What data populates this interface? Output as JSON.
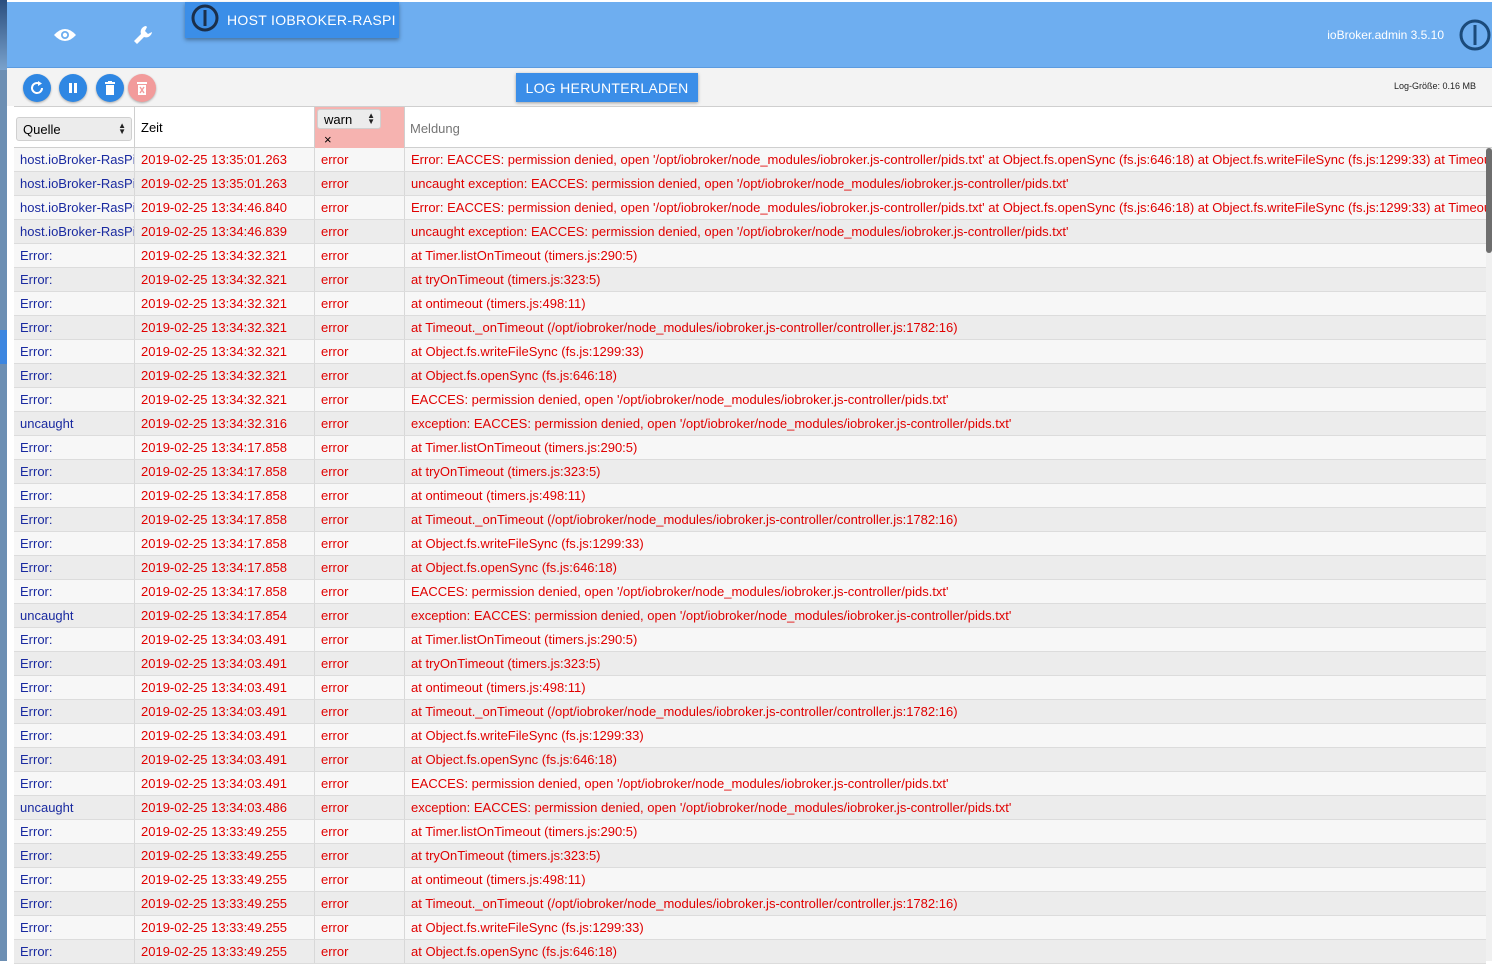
{
  "header": {
    "host_tab_label": "HOST IOBROKER-RASPI",
    "version": "ioBroker.admin 3.5.10",
    "icons": [
      "eye-icon",
      "wrench-icon",
      "iobroker-logo"
    ]
  },
  "toolbar": {
    "download_label": "LOG HERUNTERLADEN",
    "log_size": "Log-Größe: 0.16 MB",
    "buttons": [
      "refresh-icon",
      "pause-icon",
      "trash-icon",
      "delete-disabled-icon"
    ]
  },
  "table": {
    "source_filter": "Quelle",
    "time_header": "Zeit",
    "severity_filter": "warn",
    "clear_filter": "×",
    "message_placeholder": "Meldung",
    "rows": [
      {
        "src": "host.ioBroker-RasPi",
        "time": "2019-02-25 13:35:01.263",
        "sev": "error",
        "msg": "Error: EACCES: permission denied, open '/opt/iobroker/node_modules/iobroker.js-controller/pids.txt' at Object.fs.openSync (fs.js:646:18) at Object.fs.writeFileSync (fs.js:1299:33) at Timeout._onTimeout"
      },
      {
        "src": "host.ioBroker-RasPi",
        "time": "2019-02-25 13:35:01.263",
        "sev": "error",
        "msg": "uncaught exception: EACCES: permission denied, open '/opt/iobroker/node_modules/iobroker.js-controller/pids.txt'"
      },
      {
        "src": "host.ioBroker-RasPi",
        "time": "2019-02-25 13:34:46.840",
        "sev": "error",
        "msg": "Error: EACCES: permission denied, open '/opt/iobroker/node_modules/iobroker.js-controller/pids.txt' at Object.fs.openSync (fs.js:646:18) at Object.fs.writeFileSync (fs.js:1299:33) at Timeout._onTimeout"
      },
      {
        "src": "host.ioBroker-RasPi",
        "time": "2019-02-25 13:34:46.839",
        "sev": "error",
        "msg": "uncaught exception: EACCES: permission denied, open '/opt/iobroker/node_modules/iobroker.js-controller/pids.txt'"
      },
      {
        "src": "Error:",
        "time": "2019-02-25 13:34:32.321",
        "sev": "error",
        "msg": "at Timer.listOnTimeout (timers.js:290:5)"
      },
      {
        "src": "Error:",
        "time": "2019-02-25 13:34:32.321",
        "sev": "error",
        "msg": "at tryOnTimeout (timers.js:323:5)"
      },
      {
        "src": "Error:",
        "time": "2019-02-25 13:34:32.321",
        "sev": "error",
        "msg": "at ontimeout (timers.js:498:11)"
      },
      {
        "src": "Error:",
        "time": "2019-02-25 13:34:32.321",
        "sev": "error",
        "msg": "at Timeout._onTimeout (/opt/iobroker/node_modules/iobroker.js-controller/controller.js:1782:16)"
      },
      {
        "src": "Error:",
        "time": "2019-02-25 13:34:32.321",
        "sev": "error",
        "msg": "at Object.fs.writeFileSync (fs.js:1299:33)"
      },
      {
        "src": "Error:",
        "time": "2019-02-25 13:34:32.321",
        "sev": "error",
        "msg": "at Object.fs.openSync (fs.js:646:18)"
      },
      {
        "src": "Error:",
        "time": "2019-02-25 13:34:32.321",
        "sev": "error",
        "msg": "EACCES: permission denied, open '/opt/iobroker/node_modules/iobroker.js-controller/pids.txt'"
      },
      {
        "src": "uncaught",
        "time": "2019-02-25 13:34:32.316",
        "sev": "error",
        "msg": "exception: EACCES: permission denied, open '/opt/iobroker/node_modules/iobroker.js-controller/pids.txt'"
      },
      {
        "src": "Error:",
        "time": "2019-02-25 13:34:17.858",
        "sev": "error",
        "msg": "at Timer.listOnTimeout (timers.js:290:5)"
      },
      {
        "src": "Error:",
        "time": "2019-02-25 13:34:17.858",
        "sev": "error",
        "msg": "at tryOnTimeout (timers.js:323:5)"
      },
      {
        "src": "Error:",
        "time": "2019-02-25 13:34:17.858",
        "sev": "error",
        "msg": "at ontimeout (timers.js:498:11)"
      },
      {
        "src": "Error:",
        "time": "2019-02-25 13:34:17.858",
        "sev": "error",
        "msg": "at Timeout._onTimeout (/opt/iobroker/node_modules/iobroker.js-controller/controller.js:1782:16)"
      },
      {
        "src": "Error:",
        "time": "2019-02-25 13:34:17.858",
        "sev": "error",
        "msg": "at Object.fs.writeFileSync (fs.js:1299:33)"
      },
      {
        "src": "Error:",
        "time": "2019-02-25 13:34:17.858",
        "sev": "error",
        "msg": "at Object.fs.openSync (fs.js:646:18)"
      },
      {
        "src": "Error:",
        "time": "2019-02-25 13:34:17.858",
        "sev": "error",
        "msg": "EACCES: permission denied, open '/opt/iobroker/node_modules/iobroker.js-controller/pids.txt'"
      },
      {
        "src": "uncaught",
        "time": "2019-02-25 13:34:17.854",
        "sev": "error",
        "msg": "exception: EACCES: permission denied, open '/opt/iobroker/node_modules/iobroker.js-controller/pids.txt'"
      },
      {
        "src": "Error:",
        "time": "2019-02-25 13:34:03.491",
        "sev": "error",
        "msg": "at Timer.listOnTimeout (timers.js:290:5)"
      },
      {
        "src": "Error:",
        "time": "2019-02-25 13:34:03.491",
        "sev": "error",
        "msg": "at tryOnTimeout (timers.js:323:5)"
      },
      {
        "src": "Error:",
        "time": "2019-02-25 13:34:03.491",
        "sev": "error",
        "msg": "at ontimeout (timers.js:498:11)"
      },
      {
        "src": "Error:",
        "time": "2019-02-25 13:34:03.491",
        "sev": "error",
        "msg": "at Timeout._onTimeout (/opt/iobroker/node_modules/iobroker.js-controller/controller.js:1782:16)"
      },
      {
        "src": "Error:",
        "time": "2019-02-25 13:34:03.491",
        "sev": "error",
        "msg": "at Object.fs.writeFileSync (fs.js:1299:33)"
      },
      {
        "src": "Error:",
        "time": "2019-02-25 13:34:03.491",
        "sev": "error",
        "msg": "at Object.fs.openSync (fs.js:646:18)"
      },
      {
        "src": "Error:",
        "time": "2019-02-25 13:34:03.491",
        "sev": "error",
        "msg": "EACCES: permission denied, open '/opt/iobroker/node_modules/iobroker.js-controller/pids.txt'"
      },
      {
        "src": "uncaught",
        "time": "2019-02-25 13:34:03.486",
        "sev": "error",
        "msg": "exception: EACCES: permission denied, open '/opt/iobroker/node_modules/iobroker.js-controller/pids.txt'"
      },
      {
        "src": "Error:",
        "time": "2019-02-25 13:33:49.255",
        "sev": "error",
        "msg": "at Timer.listOnTimeout (timers.js:290:5)"
      },
      {
        "src": "Error:",
        "time": "2019-02-25 13:33:49.255",
        "sev": "error",
        "msg": "at tryOnTimeout (timers.js:323:5)"
      },
      {
        "src": "Error:",
        "time": "2019-02-25 13:33:49.255",
        "sev": "error",
        "msg": "at ontimeout (timers.js:498:11)"
      },
      {
        "src": "Error:",
        "time": "2019-02-25 13:33:49.255",
        "sev": "error",
        "msg": "at Timeout._onTimeout (/opt/iobroker/node_modules/iobroker.js-controller/controller.js:1782:16)"
      },
      {
        "src": "Error:",
        "time": "2019-02-25 13:33:49.255",
        "sev": "error",
        "msg": "at Object.fs.writeFileSync (fs.js:1299:33)"
      },
      {
        "src": "Error:",
        "time": "2019-02-25 13:33:49.255",
        "sev": "error",
        "msg": "at Object.fs.openSync (fs.js:646:18)"
      }
    ]
  },
  "colors": {
    "header_bg": "#6eaef0",
    "accent": "#3b8ee8",
    "error_text": "#e00000",
    "source_text": "#1a2aa0",
    "severity_filter_bg": "#f6b3b0"
  }
}
